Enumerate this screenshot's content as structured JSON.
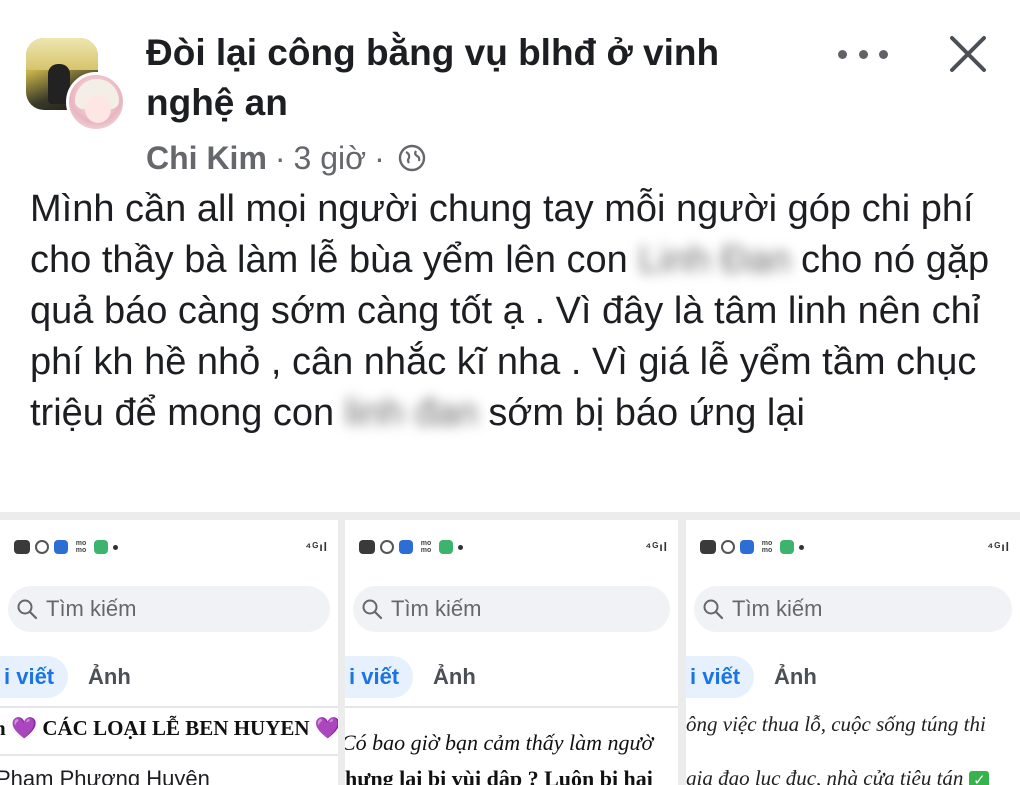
{
  "post": {
    "group_name": "Đòi lại công bằng vụ blhđ ở vinh nghệ an",
    "author": "Chi Kim",
    "separator": "·",
    "time": "3 giờ",
    "audience_icon": "globe-icon",
    "body": {
      "part1": "Mình cần all mọi người chung tay mỗi người góp chi phí cho thầy bà làm lễ bùa yểm lên con ",
      "blurred_name_1": "Linh Đan",
      "part2": " cho nó gặp quả báo càng sớm càng tốt ạ . Vì đây là tâm linh nên chỉ phí kh hề nhỏ , cân nhắc kĩ nha . Vì giá lễ yểm tầm chục triệu để mong con ",
      "blurred_name_2": "linh đan",
      "part3": " sớm bị báo ứng lại"
    }
  },
  "screenshots": [
    {
      "search_placeholder": "Tìm kiếm",
      "tab_posts": "i viết",
      "tab_photos": "Ảnh",
      "line1_prefix": "n ",
      "line1_text": " CÁC LOẠI LỄ BEN HUYEN ",
      "line2": "Phạm Phương Huyên"
    },
    {
      "search_placeholder": "Tìm kiếm",
      "tab_posts": "i viết",
      "tab_photos": "Ảnh",
      "line1": "Có bao giờ bạn cảm thấy làm ngườ",
      "line2": "hưng lại bị vùi dập ? Luôn bị hại"
    },
    {
      "search_placeholder": "Tìm kiếm",
      "tab_posts": "i viết",
      "tab_photos": "Ảnh",
      "line1": "ông việc thua lỗ, cuộc sống túng thi",
      "line2": "gia đạo lục đục, nhà cửa tiêu tán"
    }
  ],
  "status_bar": {
    "signal": "⁴ᴳıl"
  },
  "colors": {
    "accent_blue": "#1b74e4",
    "meta_gray": "#65676b",
    "text_dark": "#1c1e21"
  }
}
